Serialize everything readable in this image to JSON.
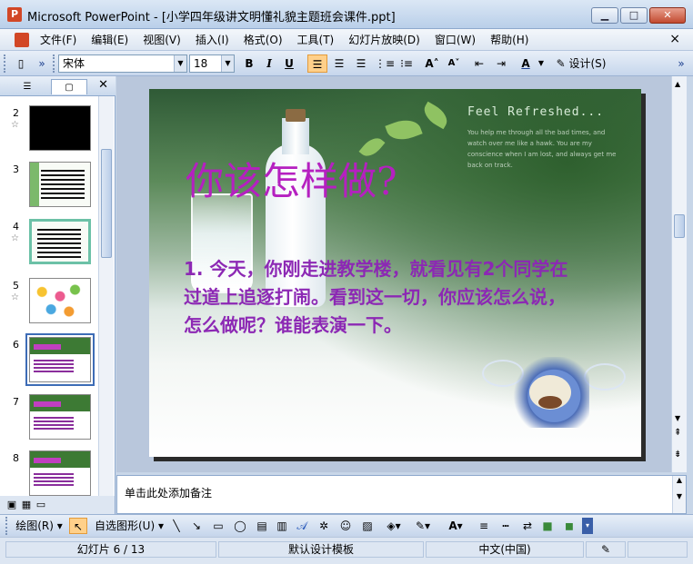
{
  "window": {
    "title": "Microsoft PowerPoint - [小学四年级讲文明懂礼貌主题班会课件.ppt]",
    "minimize": "▁",
    "maximize": "□",
    "close": "✕"
  },
  "menu": {
    "items": [
      "文件(F)",
      "编辑(E)",
      "视图(V)",
      "插入(I)",
      "格式(O)",
      "工具(T)",
      "幻灯片放映(D)",
      "窗口(W)",
      "帮助(H)"
    ],
    "doc_close": "×"
  },
  "toolbar": {
    "font_name": "宋体",
    "font_size": "18",
    "bold": "B",
    "italic": "I",
    "underline": "U",
    "design": "设计(S)",
    "font_color_label": "A"
  },
  "slide_pane": {
    "tab_outline": "☰",
    "tab_slides": "▢",
    "close": "✕",
    "slides": [
      {
        "number": "2",
        "star": "☆"
      },
      {
        "number": "3",
        "star": ""
      },
      {
        "number": "4",
        "star": "☆"
      },
      {
        "number": "5",
        "star": "☆"
      },
      {
        "number": "6",
        "star": ""
      },
      {
        "number": "7",
        "star": ""
      },
      {
        "number": "8",
        "star": ""
      }
    ]
  },
  "slide": {
    "feel_title": "Feel Refreshed...",
    "feel_text": "You help me through all the bad times, and watch over me like a hawk. You are my conscience when I am lost, and always get me back on track.",
    "title": "你该怎样做?",
    "body": "1. 今天，你刚走进教学楼，就看见有2个同学在过道上追逐打闹。看到这一切，你应该怎么说，怎么做呢？谁能表演一下。"
  },
  "notes": {
    "placeholder": "单击此处添加备注"
  },
  "drawbar": {
    "draw": "绘图(R)",
    "autoshapes": "自选图形(U)"
  },
  "status": {
    "slide": "幻灯片 6 / 13",
    "template": "默认设计模板",
    "language": "中文(中国)"
  },
  "colors": {
    "title_magenta": "#b520c0",
    "body_purple": "#8c28b4"
  }
}
